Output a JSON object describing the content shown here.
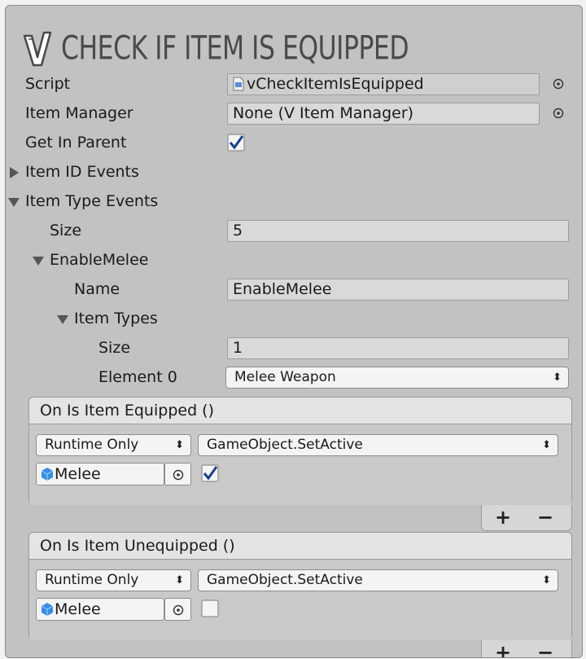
{
  "header": {
    "title": "CHECK IF ITEM IS EQUIPPED",
    "logo_icon": "v-logo-icon"
  },
  "fields": {
    "script": {
      "label": "Script",
      "value": "vCheckItemIsEquipped"
    },
    "item_manager": {
      "label": "Item Manager",
      "value": "None (V Item Manager)"
    },
    "get_in_parent": {
      "label": "Get In Parent",
      "checked": true
    },
    "item_id_events": {
      "label": "Item ID Events",
      "expanded": false
    },
    "item_type_events": {
      "label": "Item Type Events",
      "expanded": true
    },
    "size": {
      "label": "Size",
      "value": "5"
    },
    "enable_melee": {
      "label": "EnableMelee",
      "expanded": true
    },
    "name": {
      "label": "Name",
      "value": "EnableMelee"
    },
    "item_types": {
      "label": "Item Types",
      "expanded": true
    },
    "types_size": {
      "label": "Size",
      "value": "1"
    },
    "element0": {
      "label": "Element 0",
      "value": "Melee Weapon"
    }
  },
  "events": [
    {
      "title": "On Is Item Equipped ()",
      "mode": "Runtime Only",
      "function": "GameObject.SetActive",
      "object": "Melee",
      "checked": true,
      "add": "+",
      "remove": "−"
    },
    {
      "title": "On Is Item Unequipped ()",
      "mode": "Runtime Only",
      "function": "GameObject.SetActive",
      "object": "Melee",
      "checked": false,
      "add": "+",
      "remove": "−"
    }
  ],
  "glyphs": {
    "updown": "⬍"
  },
  "colors": {
    "panel": "#c2c2c2",
    "field": "#d9d9d9",
    "check": "#1a3f8a",
    "cube": "#3a8ee0"
  }
}
